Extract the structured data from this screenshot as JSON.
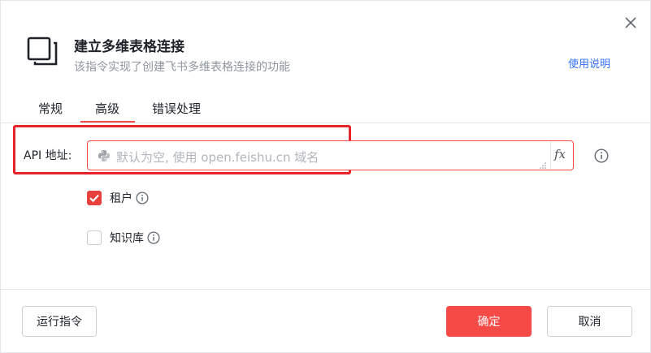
{
  "dialog": {
    "title": "建立多维表格连接",
    "subtitle": "该指令实现了创建飞书多维表格连接的功能",
    "help_link": "使用说明"
  },
  "tabs": [
    {
      "label": "常规",
      "active": false
    },
    {
      "label": "高级",
      "active": true
    },
    {
      "label": "错误处理",
      "active": false
    }
  ],
  "api_field": {
    "label": "API 地址:",
    "placeholder": "默认为空, 使用 open.feishu.cn 域名",
    "value": "",
    "fx_label": "fx"
  },
  "options": {
    "tenant": {
      "label": "租户",
      "checked": true
    },
    "knowledge_base": {
      "label": "知识库",
      "checked": false
    }
  },
  "footer": {
    "run_label": "运行指令",
    "ok_label": "确定",
    "cancel_label": "取消"
  },
  "colors": {
    "accent": "#f54a45",
    "highlight_box": "#e8232a",
    "link": "#3370ff",
    "muted_text": "#8f959e"
  },
  "icons": {
    "close": "close-icon",
    "header": "copy-icon",
    "python": "python-icon",
    "info": "info-icon"
  }
}
